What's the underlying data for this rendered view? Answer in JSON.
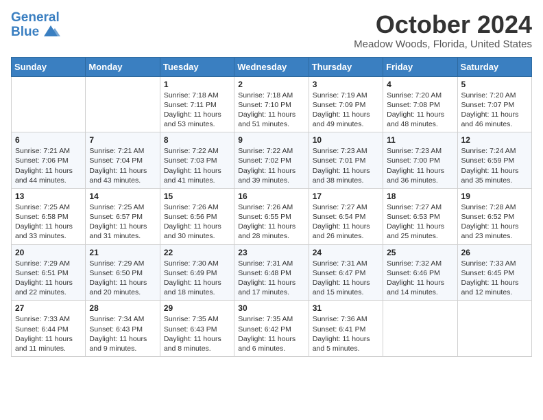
{
  "header": {
    "logo_line1": "General",
    "logo_line2": "Blue",
    "title": "October 2024",
    "subtitle": "Meadow Woods, Florida, United States"
  },
  "days_of_week": [
    "Sunday",
    "Monday",
    "Tuesday",
    "Wednesday",
    "Thursday",
    "Friday",
    "Saturday"
  ],
  "weeks": [
    [
      {
        "day": "",
        "info": ""
      },
      {
        "day": "",
        "info": ""
      },
      {
        "day": "1",
        "info": "Sunrise: 7:18 AM\nSunset: 7:11 PM\nDaylight: 11 hours and 53 minutes."
      },
      {
        "day": "2",
        "info": "Sunrise: 7:18 AM\nSunset: 7:10 PM\nDaylight: 11 hours and 51 minutes."
      },
      {
        "day": "3",
        "info": "Sunrise: 7:19 AM\nSunset: 7:09 PM\nDaylight: 11 hours and 49 minutes."
      },
      {
        "day": "4",
        "info": "Sunrise: 7:20 AM\nSunset: 7:08 PM\nDaylight: 11 hours and 48 minutes."
      },
      {
        "day": "5",
        "info": "Sunrise: 7:20 AM\nSunset: 7:07 PM\nDaylight: 11 hours and 46 minutes."
      }
    ],
    [
      {
        "day": "6",
        "info": "Sunrise: 7:21 AM\nSunset: 7:06 PM\nDaylight: 11 hours and 44 minutes."
      },
      {
        "day": "7",
        "info": "Sunrise: 7:21 AM\nSunset: 7:04 PM\nDaylight: 11 hours and 43 minutes."
      },
      {
        "day": "8",
        "info": "Sunrise: 7:22 AM\nSunset: 7:03 PM\nDaylight: 11 hours and 41 minutes."
      },
      {
        "day": "9",
        "info": "Sunrise: 7:22 AM\nSunset: 7:02 PM\nDaylight: 11 hours and 39 minutes."
      },
      {
        "day": "10",
        "info": "Sunrise: 7:23 AM\nSunset: 7:01 PM\nDaylight: 11 hours and 38 minutes."
      },
      {
        "day": "11",
        "info": "Sunrise: 7:23 AM\nSunset: 7:00 PM\nDaylight: 11 hours and 36 minutes."
      },
      {
        "day": "12",
        "info": "Sunrise: 7:24 AM\nSunset: 6:59 PM\nDaylight: 11 hours and 35 minutes."
      }
    ],
    [
      {
        "day": "13",
        "info": "Sunrise: 7:25 AM\nSunset: 6:58 PM\nDaylight: 11 hours and 33 minutes."
      },
      {
        "day": "14",
        "info": "Sunrise: 7:25 AM\nSunset: 6:57 PM\nDaylight: 11 hours and 31 minutes."
      },
      {
        "day": "15",
        "info": "Sunrise: 7:26 AM\nSunset: 6:56 PM\nDaylight: 11 hours and 30 minutes."
      },
      {
        "day": "16",
        "info": "Sunrise: 7:26 AM\nSunset: 6:55 PM\nDaylight: 11 hours and 28 minutes."
      },
      {
        "day": "17",
        "info": "Sunrise: 7:27 AM\nSunset: 6:54 PM\nDaylight: 11 hours and 26 minutes."
      },
      {
        "day": "18",
        "info": "Sunrise: 7:27 AM\nSunset: 6:53 PM\nDaylight: 11 hours and 25 minutes."
      },
      {
        "day": "19",
        "info": "Sunrise: 7:28 AM\nSunset: 6:52 PM\nDaylight: 11 hours and 23 minutes."
      }
    ],
    [
      {
        "day": "20",
        "info": "Sunrise: 7:29 AM\nSunset: 6:51 PM\nDaylight: 11 hours and 22 minutes."
      },
      {
        "day": "21",
        "info": "Sunrise: 7:29 AM\nSunset: 6:50 PM\nDaylight: 11 hours and 20 minutes."
      },
      {
        "day": "22",
        "info": "Sunrise: 7:30 AM\nSunset: 6:49 PM\nDaylight: 11 hours and 18 minutes."
      },
      {
        "day": "23",
        "info": "Sunrise: 7:31 AM\nSunset: 6:48 PM\nDaylight: 11 hours and 17 minutes."
      },
      {
        "day": "24",
        "info": "Sunrise: 7:31 AM\nSunset: 6:47 PM\nDaylight: 11 hours and 15 minutes."
      },
      {
        "day": "25",
        "info": "Sunrise: 7:32 AM\nSunset: 6:46 PM\nDaylight: 11 hours and 14 minutes."
      },
      {
        "day": "26",
        "info": "Sunrise: 7:33 AM\nSunset: 6:45 PM\nDaylight: 11 hours and 12 minutes."
      }
    ],
    [
      {
        "day": "27",
        "info": "Sunrise: 7:33 AM\nSunset: 6:44 PM\nDaylight: 11 hours and 11 minutes."
      },
      {
        "day": "28",
        "info": "Sunrise: 7:34 AM\nSunset: 6:43 PM\nDaylight: 11 hours and 9 minutes."
      },
      {
        "day": "29",
        "info": "Sunrise: 7:35 AM\nSunset: 6:43 PM\nDaylight: 11 hours and 8 minutes."
      },
      {
        "day": "30",
        "info": "Sunrise: 7:35 AM\nSunset: 6:42 PM\nDaylight: 11 hours and 6 minutes."
      },
      {
        "day": "31",
        "info": "Sunrise: 7:36 AM\nSunset: 6:41 PM\nDaylight: 11 hours and 5 minutes."
      },
      {
        "day": "",
        "info": ""
      },
      {
        "day": "",
        "info": ""
      }
    ]
  ]
}
